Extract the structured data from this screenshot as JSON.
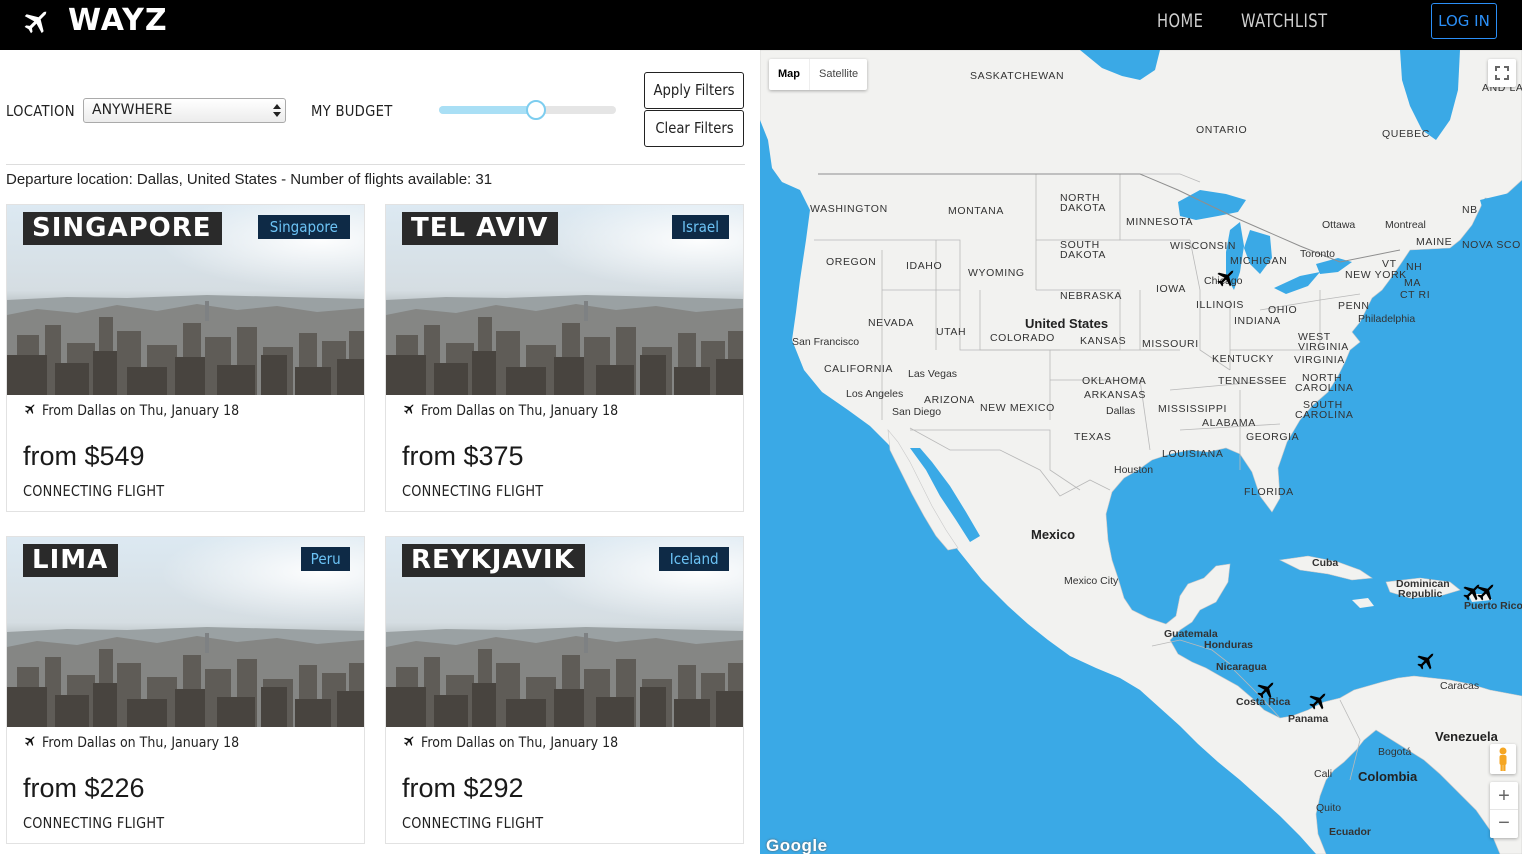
{
  "nav": {
    "brand": "WAYZ",
    "links": [
      "HOME",
      "WATCHLIST"
    ],
    "login_label": "LOG IN"
  },
  "filters": {
    "location_label": "LOCATION",
    "location_value": "ANYWHERE",
    "budget_label": "MY BUDGET",
    "budget_level": 0.55,
    "apply_label": "Apply Filters",
    "clear_label": "Clear Filters"
  },
  "departure_text": "Departure location: Dallas, United States - Number of flights available: 31",
  "cards": [
    {
      "city": "SINGAPORE",
      "country": "Singapore",
      "from": "From Dallas on Thu, January 18",
      "price": "from $549",
      "type": "CONNECTING FLIGHT"
    },
    {
      "city": "TEL AVIV",
      "country": "Israel",
      "from": "From Dallas on Thu, January 18",
      "price": "from $375",
      "type": "CONNECTING FLIGHT"
    },
    {
      "city": "LIMA",
      "country": "Peru",
      "from": "From Dallas on Thu, January 18",
      "price": "from $226",
      "type": "CONNECTING FLIGHT"
    },
    {
      "city": "REYKJAVIK",
      "country": "Iceland",
      "from": "From Dallas on Thu, January 18",
      "price": "from $292",
      "type": "CONNECTING FLIGHT"
    }
  ],
  "map": {
    "type_map": "Map",
    "type_satellite": "Satellite",
    "zoom_in": "+",
    "zoom_out": "−",
    "attribution": "Google",
    "labels": [
      {
        "t": "SASKATCHEWAN",
        "k": "region"
      },
      {
        "t": "ONTARIO",
        "k": "region"
      },
      {
        "t": "QUEBEC",
        "k": "region"
      },
      {
        "t": "NB",
        "k": "region"
      },
      {
        "t": "AND LA",
        "k": "region"
      },
      {
        "t": "WASHINGTON",
        "k": "region"
      },
      {
        "t": "MONTANA",
        "k": "region"
      },
      {
        "t": "NORTH",
        "k": "region"
      },
      {
        "t": "DAKOTA",
        "k": "region"
      },
      {
        "t": "MINNESOTA",
        "k": "region"
      },
      {
        "t": "Ottawa",
        "k": "city"
      },
      {
        "t": "Montreal",
        "k": "city"
      },
      {
        "t": "MAINE",
        "k": "region"
      },
      {
        "t": "NOVA SCO",
        "k": "region"
      },
      {
        "t": "SOUTH",
        "k": "region"
      },
      {
        "t": "DAKOTA",
        "k": "region"
      },
      {
        "t": "WISCONSIN",
        "k": "region"
      },
      {
        "t": "OREGON",
        "k": "region"
      },
      {
        "t": "IDAHO",
        "k": "region"
      },
      {
        "t": "WYOMING",
        "k": "region"
      },
      {
        "t": "MICHIGAN",
        "k": "region"
      },
      {
        "t": "Toronto",
        "k": "city"
      },
      {
        "t": "VT",
        "k": "region"
      },
      {
        "t": "NH",
        "k": "region"
      },
      {
        "t": "NEW YORK",
        "k": "region"
      },
      {
        "t": "Chicago",
        "k": "city"
      },
      {
        "t": "IOWA",
        "k": "region"
      },
      {
        "t": "MA",
        "k": "region"
      },
      {
        "t": "CT RI",
        "k": "region"
      },
      {
        "t": "NEBRASKA",
        "k": "region"
      },
      {
        "t": "ILLINOIS",
        "k": "region"
      },
      {
        "t": "PENN",
        "k": "region"
      },
      {
        "t": "OHIO",
        "k": "region"
      },
      {
        "t": "NEVADA",
        "k": "region"
      },
      {
        "t": "UTAH",
        "k": "region"
      },
      {
        "t": "United States",
        "k": "big"
      },
      {
        "t": "INDIANA",
        "k": "region"
      },
      {
        "t": "Philadelphia",
        "k": "city"
      },
      {
        "t": "COLORADO",
        "k": "region"
      },
      {
        "t": "KANSAS",
        "k": "region"
      },
      {
        "t": "MISSOURI",
        "k": "region"
      },
      {
        "t": "WEST",
        "k": "region"
      },
      {
        "t": "VIRGINIA",
        "k": "region"
      },
      {
        "t": "San Francisco",
        "k": "city"
      },
      {
        "t": "KENTUCKY",
        "k": "region"
      },
      {
        "t": "VIRGINIA",
        "k": "region"
      },
      {
        "t": "CALIFORNIA",
        "k": "region"
      },
      {
        "t": "Las Vegas",
        "k": "city"
      },
      {
        "t": "TENNESSEE",
        "k": "region"
      },
      {
        "t": "NORTH",
        "k": "region"
      },
      {
        "t": "CAROLINA",
        "k": "region"
      },
      {
        "t": "OKLAHOMA",
        "k": "region"
      },
      {
        "t": "Los Angeles",
        "k": "city"
      },
      {
        "t": "ARIZONA",
        "k": "region"
      },
      {
        "t": "ARKANSAS",
        "k": "region"
      },
      {
        "t": "San Diego",
        "k": "city"
      },
      {
        "t": "NEW MEXICO",
        "k": "region"
      },
      {
        "t": "Dallas",
        "k": "city"
      },
      {
        "t": "MISSISSIPPI",
        "k": "region"
      },
      {
        "t": "SOUTH",
        "k": "region"
      },
      {
        "t": "CAROLINA",
        "k": "region"
      },
      {
        "t": "ALABAMA",
        "k": "region"
      },
      {
        "t": "TEXAS",
        "k": "region"
      },
      {
        "t": "GEORGIA",
        "k": "region"
      },
      {
        "t": "LOUISIANA",
        "k": "region"
      },
      {
        "t": "Houston",
        "k": "city"
      },
      {
        "t": "FLORIDA",
        "k": "region"
      },
      {
        "t": "Mexico",
        "k": "big"
      },
      {
        "t": "Cuba",
        "k": "cityb"
      },
      {
        "t": "Mexico City",
        "k": "city"
      },
      {
        "t": "Dominican",
        "k": "cityb"
      },
      {
        "t": "Republic",
        "k": "cityb"
      },
      {
        "t": "Puerto Rico",
        "k": "cityb"
      },
      {
        "t": "Guatemala",
        "k": "cityb"
      },
      {
        "t": "Honduras",
        "k": "cityb"
      },
      {
        "t": "Nicaragua",
        "k": "cityb"
      },
      {
        "t": "Caracas",
        "k": "city"
      },
      {
        "t": "Costa Rica",
        "k": "cityb"
      },
      {
        "t": "Panama",
        "k": "cityb"
      },
      {
        "t": "Venezuela",
        "k": "big"
      },
      {
        "t": "Bogotá",
        "k": "city"
      },
      {
        "t": "Cali",
        "k": "city"
      },
      {
        "t": "Colombia",
        "k": "big"
      },
      {
        "t": "Quito",
        "k": "city"
      },
      {
        "t": "Ecuador",
        "k": "cityb"
      }
    ]
  }
}
